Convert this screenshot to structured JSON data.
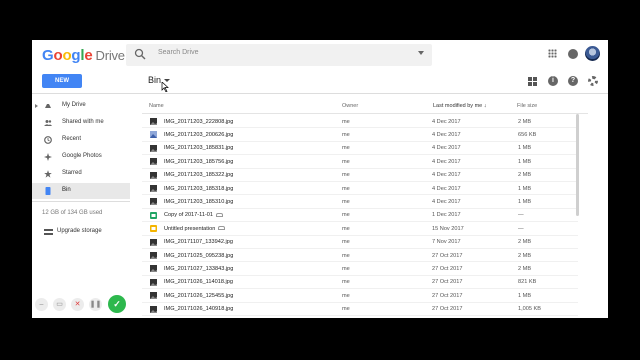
{
  "header": {
    "logo_google": "Google",
    "logo_drive": "Drive",
    "search_placeholder": "Search Drive"
  },
  "toolbar": {
    "new_label": "NEW",
    "breadcrumb": "Bin"
  },
  "sidebar": {
    "items": [
      {
        "label": "My Drive",
        "icon": "drive-icon"
      },
      {
        "label": "Shared with me",
        "icon": "people-icon"
      },
      {
        "label": "Recent",
        "icon": "clock-icon"
      },
      {
        "label": "Google Photos",
        "icon": "photos-icon"
      },
      {
        "label": "Starred",
        "icon": "star-icon"
      },
      {
        "label": "Bin",
        "icon": "bin-icon"
      }
    ],
    "quota": "12 GB of 134 GB used",
    "upgrade": "Upgrade storage"
  },
  "recorder": {
    "ok_symbol": "✓"
  },
  "list": {
    "columns": {
      "name": "Name",
      "owner": "Owner",
      "modified": "Last modified by me",
      "size": "File size"
    },
    "rows": [
      {
        "name": "IMG_20171203_222808.jpg",
        "owner": "me",
        "date": "4 Dec 2017",
        "size": "2 MB",
        "icon": "image"
      },
      {
        "name": "IMG_20171203_200626.jpg",
        "owner": "me",
        "date": "4 Dec 2017",
        "size": "656 KB",
        "icon": "image-blue"
      },
      {
        "name": "IMG_20171203_185831.jpg",
        "owner": "me",
        "date": "4 Dec 2017",
        "size": "1 MB",
        "icon": "image"
      },
      {
        "name": "IMG_20171203_185756.jpg",
        "owner": "me",
        "date": "4 Dec 2017",
        "size": "1 MB",
        "icon": "image"
      },
      {
        "name": "IMG_20171203_185322.jpg",
        "owner": "me",
        "date": "4 Dec 2017",
        "size": "2 MB",
        "icon": "image"
      },
      {
        "name": "IMG_20171203_185318.jpg",
        "owner": "me",
        "date": "4 Dec 2017",
        "size": "1 MB",
        "icon": "image"
      },
      {
        "name": "IMG_20171203_185310.jpg",
        "owner": "me",
        "date": "4 Dec 2017",
        "size": "1 MB",
        "icon": "image"
      },
      {
        "name": "Copy of 2017-11-01",
        "owner": "me",
        "date": "1 Dec 2017",
        "size": "—",
        "icon": "sheet",
        "shared": true
      },
      {
        "name": "Untitled presentation",
        "owner": "me",
        "date": "15 Nov 2017",
        "size": "—",
        "icon": "slides",
        "shared": true
      },
      {
        "name": "IMG_20171107_133942.jpg",
        "owner": "me",
        "date": "7 Nov 2017",
        "size": "2 MB",
        "icon": "image"
      },
      {
        "name": "IMG_20171025_095238.jpg",
        "owner": "me",
        "date": "27 Oct 2017",
        "size": "2 MB",
        "icon": "image"
      },
      {
        "name": "IMG_20171027_133843.jpg",
        "owner": "me",
        "date": "27 Oct 2017",
        "size": "2 MB",
        "icon": "image"
      },
      {
        "name": "IMG_20171026_114018.jpg",
        "owner": "me",
        "date": "27 Oct 2017",
        "size": "821 KB",
        "icon": "image"
      },
      {
        "name": "IMG_20171026_125455.jpg",
        "owner": "me",
        "date": "27 Oct 2017",
        "size": "1 MB",
        "icon": "image"
      },
      {
        "name": "IMG_20171026_140918.jpg",
        "owner": "me",
        "date": "27 Oct 2017",
        "size": "1,005 KB",
        "icon": "image"
      }
    ]
  },
  "colors": {
    "accent": "#4285f4",
    "active_blue": "#4285f4",
    "ok_green": "#2db84d"
  }
}
